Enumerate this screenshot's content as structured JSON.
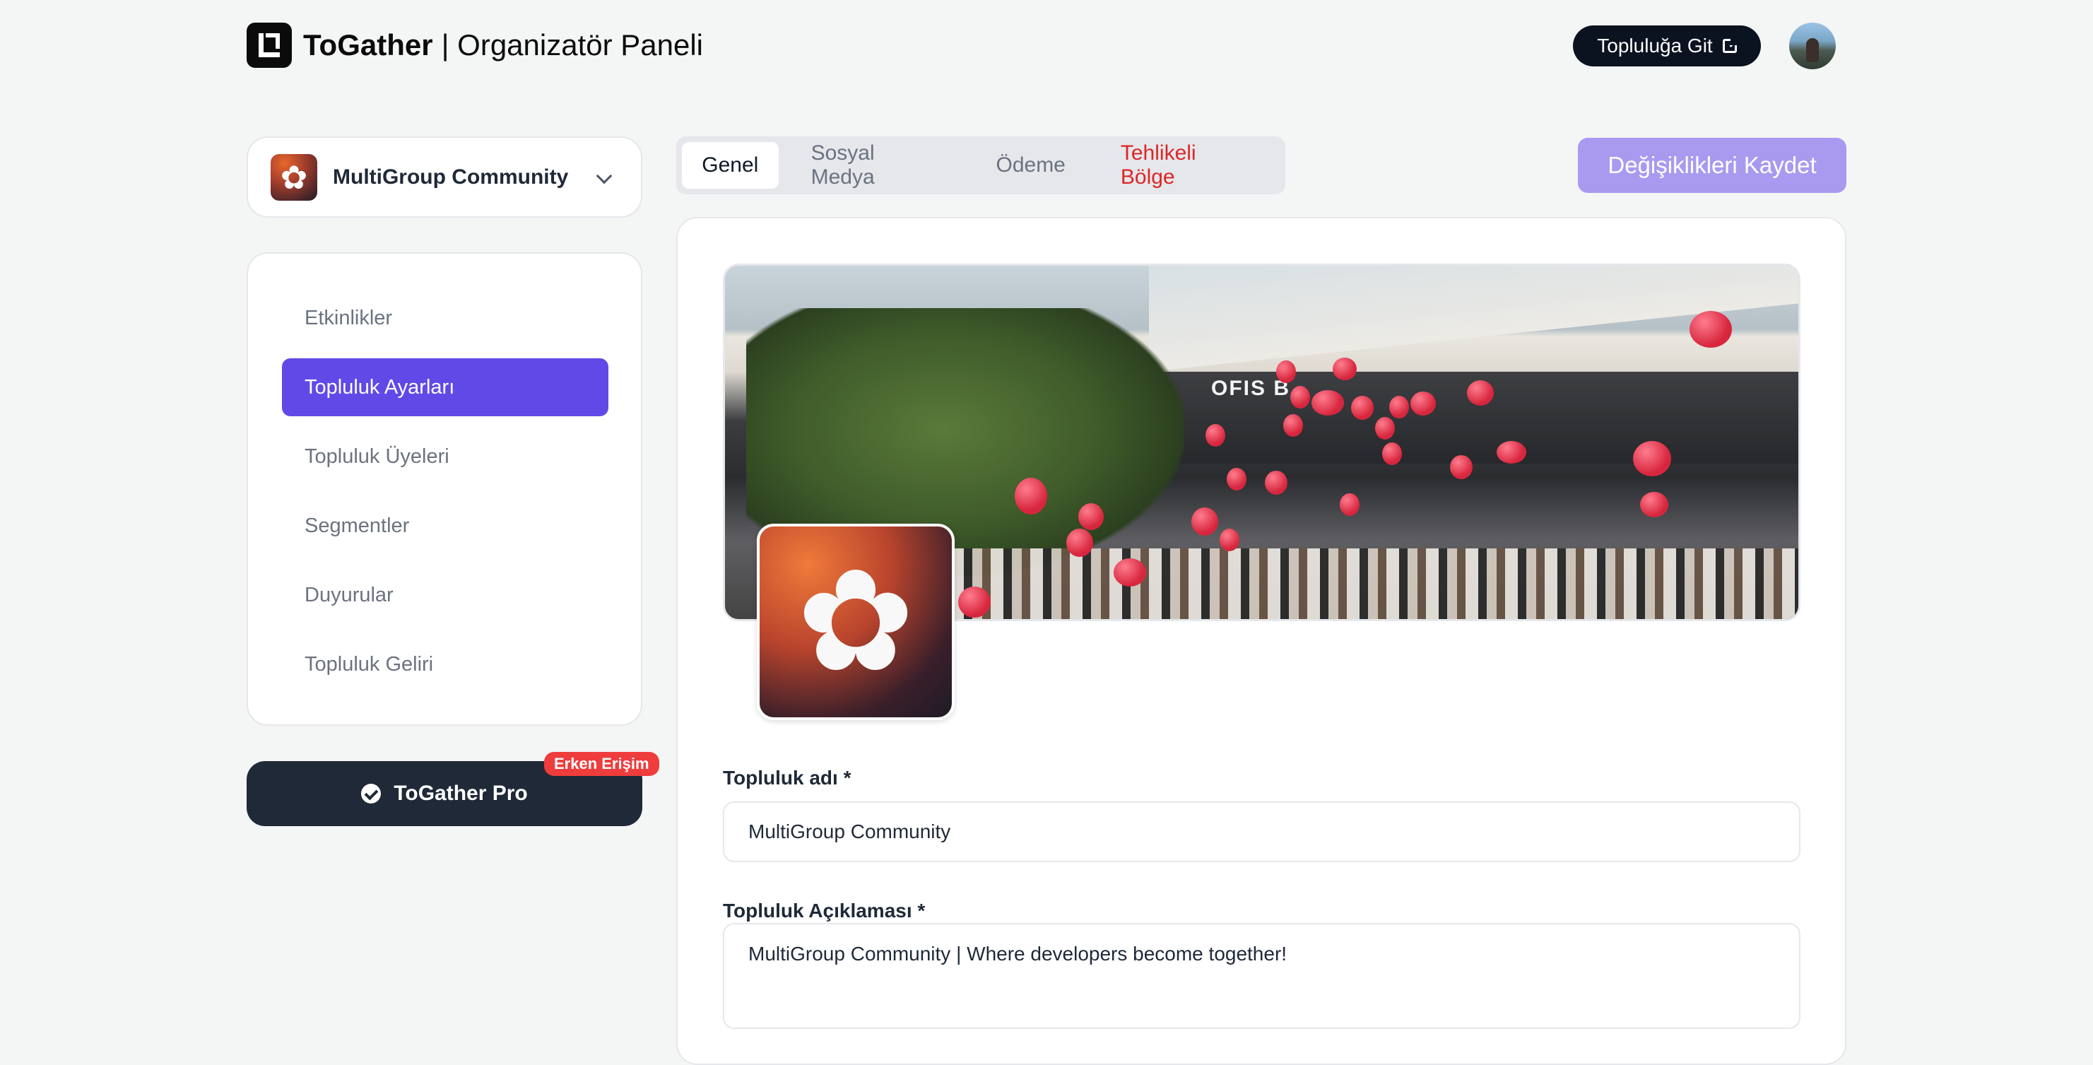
{
  "header": {
    "brand_name": "ToGather",
    "brand_sub": "| Organizatör Paneli",
    "go_community_label": "Topluluğa Git"
  },
  "sidebar": {
    "community_name": "MultiGroup Community",
    "items": [
      {
        "label": "Etkinlikler"
      },
      {
        "label": "Topluluk Ayarları"
      },
      {
        "label": "Topluluk Üyeleri"
      },
      {
        "label": "Segmentler"
      },
      {
        "label": "Duyurular"
      },
      {
        "label": "Topluluk Geliri"
      }
    ],
    "pro_label": "ToGather Pro",
    "pro_badge": "Erken Erişim"
  },
  "tabs": [
    {
      "label": "Genel"
    },
    {
      "label": "Sosyal Medya"
    },
    {
      "label": "Ödeme"
    },
    {
      "label": "Tehlikeli Bölge"
    }
  ],
  "save_label": "Değişiklikleri Kaydet",
  "cover": {
    "sign_text": "OFIS B"
  },
  "form": {
    "name_label": "Topluluk adı *",
    "name_value": "MultiGroup Community",
    "desc_label": "Topluluk Açıklaması *",
    "desc_value": "MultiGroup Community | Where developers become together!"
  },
  "colors": {
    "accent": "#6149e8",
    "save_disabled": "#a99af0",
    "danger": "#dc2626",
    "dark": "#1f2937",
    "badge": "#ef3c3c"
  }
}
